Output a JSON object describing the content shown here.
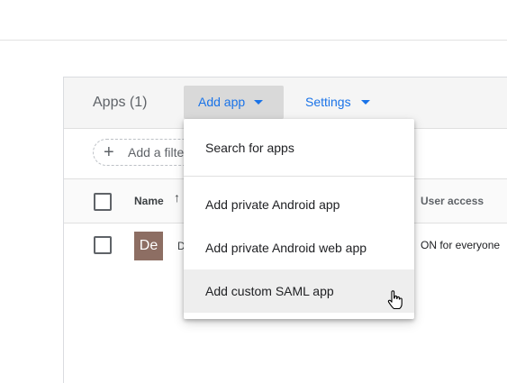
{
  "header": {
    "apps_title": "Apps (1)",
    "add_app_label": "Add app",
    "settings_label": "Settings"
  },
  "filter": {
    "add_filter_label": "Add a filter",
    "plus_icon": "plus-icon"
  },
  "table": {
    "columns": {
      "name": "Name",
      "sort_icon": "↑",
      "user_access": "User access"
    },
    "rows": [
      {
        "avatar": "De",
        "name": "D",
        "user_access": "ON for everyone"
      }
    ]
  },
  "dropdown": {
    "items": [
      {
        "label": "Search for apps"
      },
      {
        "label": "Add private Android app"
      },
      {
        "label": "Add private Android web app"
      },
      {
        "label": "Add custom SAML app"
      }
    ]
  },
  "colors": {
    "accent": "#1a73e8",
    "avatar_bg": "#8d6e63",
    "hover_bg": "#eeeeee"
  }
}
